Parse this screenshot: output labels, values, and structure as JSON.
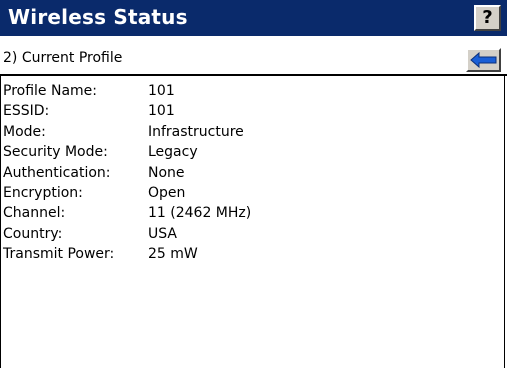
{
  "window": {
    "title": "Wireless Status",
    "help_label": "?"
  },
  "subheader": {
    "label": "2) Current Profile",
    "back_icon": "back-arrow-icon"
  },
  "colors": {
    "title_bar": "#0a2a6b",
    "arrow": "#1a5fd6"
  },
  "profile": [
    {
      "key": "Profile Name:",
      "value": "101"
    },
    {
      "key": "ESSID:",
      "value": "101"
    },
    {
      "key": "Mode:",
      "value": "Infrastructure"
    },
    {
      "key": "Security Mode:",
      "value": "Legacy"
    },
    {
      "key": "Authentication:",
      "value": "None"
    },
    {
      "key": "Encryption:",
      "value": "Open"
    },
    {
      "key": "Channel:",
      "value": "11 (2462 MHz)"
    },
    {
      "key": "Country:",
      "value": "USA"
    },
    {
      "key": "Transmit Power:",
      "value": "25 mW"
    }
  ]
}
